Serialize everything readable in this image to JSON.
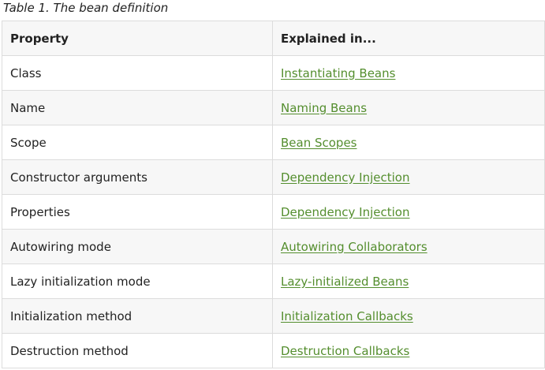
{
  "caption": "Table 1. The bean definition",
  "table": {
    "headers": [
      "Property",
      "Explained in..."
    ],
    "rows": [
      {
        "property": "Class",
        "link": "Instantiating Beans"
      },
      {
        "property": "Name",
        "link": "Naming Beans"
      },
      {
        "property": "Scope",
        "link": "Bean Scopes"
      },
      {
        "property": "Constructor arguments",
        "link": "Dependency Injection"
      },
      {
        "property": "Properties",
        "link": "Dependency Injection"
      },
      {
        "property": "Autowiring mode",
        "link": "Autowiring Collaborators"
      },
      {
        "property": "Lazy initialization mode",
        "link": "Lazy-initialized Beans"
      },
      {
        "property": "Initialization method",
        "link": "Initialization Callbacks"
      },
      {
        "property": "Destruction method",
        "link": "Destruction Callbacks"
      }
    ]
  },
  "colors": {
    "link": "#548e2e",
    "border": "#dcdcdc",
    "stripe": "#f7f7f7",
    "text": "#222222"
  }
}
